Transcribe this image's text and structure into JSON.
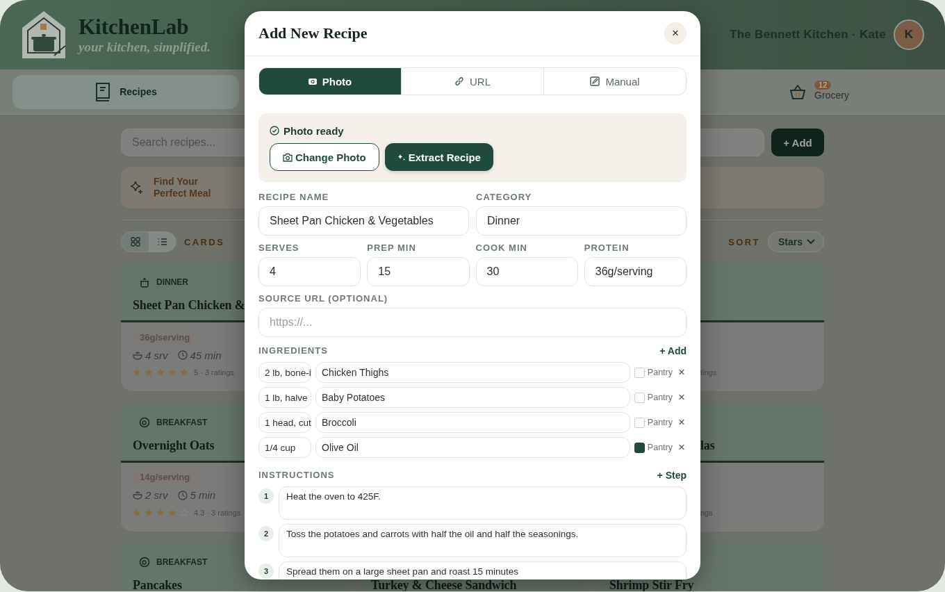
{
  "app": {
    "title": "KitchenLab",
    "tagline": "your kitchen, simplified.",
    "account": "The Bennett Kitchen · Kate",
    "avatar": "K"
  },
  "nav": [
    {
      "label": "Recipes",
      "selected": true
    },
    {
      "label": "Grocery",
      "selected": false,
      "badge": "12"
    }
  ],
  "search": {
    "placeholder": "Search recipes..."
  },
  "add_button": "+ Add",
  "banner": {
    "text": "Find Your Perfect Meal"
  },
  "view": {
    "modes": [
      {
        "selected": true
      },
      {
        "selected": false
      }
    ],
    "label": "CARDS"
  },
  "sort": {
    "label": "SORT",
    "value": "Stars"
  },
  "card_columns": [
    {
      "cards": [
        {
          "kind": "full",
          "category": "DINNER",
          "title": "Sheet Pan Chicken &",
          "protein": "36g/serving",
          "servings": "4 srv",
          "time": "45 min",
          "stars": 5,
          "rating": "5 · 3 ratings"
        },
        {
          "kind": "full",
          "category": "BREAKFAST",
          "title": "Overnight Oats",
          "protein": "14g/serving",
          "servings": "2 srv",
          "time": "5 min",
          "stars": 4,
          "rating": "4.3 · 3 ratings"
        },
        {
          "kind": "full",
          "category": "BREAKFAST",
          "title": "Pancakes"
        }
      ]
    },
    {
      "cards": [
        {
          "kind": "full",
          "title": "Turkey & Cheese Sandwich"
        }
      ]
    },
    {
      "cards": [
        {
          "kind": "fragment",
          "rating": "tings"
        },
        {
          "kind": "fragment",
          "title": "las",
          "rating": "ngs"
        },
        {
          "kind": "full",
          "title": "Shrimp Stir Fry"
        }
      ]
    }
  ],
  "modal": {
    "title": "Add New Recipe",
    "close": "×",
    "tabs": [
      {
        "label": "Photo",
        "selected": true
      },
      {
        "label": "URL",
        "selected": false
      },
      {
        "label": "Manual",
        "selected": false
      }
    ],
    "photo_panel": {
      "status": "Photo ready",
      "buttons": [
        {
          "label": "Change Photo",
          "kind": "outline"
        },
        {
          "label": "Extract Recipe",
          "kind": "primary"
        }
      ]
    },
    "fields": [
      {
        "label": "RECIPE NAME",
        "value": "Sheet Pan Chicken & Vegetables"
      },
      {
        "label": "CATEGORY",
        "value": "Dinner"
      }
    ],
    "numbers": [
      {
        "label": "SERVES",
        "value": "4"
      },
      {
        "label": "PREP MIN",
        "value": "15"
      },
      {
        "label": "COOK MIN",
        "value": "30"
      },
      {
        "label": "PROTEIN",
        "value": "36g/serving"
      }
    ],
    "source": {
      "label": "SOURCE URL (OPTIONAL)",
      "placeholder": "https://..."
    },
    "ingredients": {
      "label": "INGREDIENTS",
      "add": "+ Add",
      "rows": [
        {
          "amount": "2 lb, bone-i",
          "name": "Chicken Thighs",
          "pantry": false,
          "pantry_label": "Pantry",
          "remove": "×"
        },
        {
          "amount": "1 lb, halve",
          "name": "Baby Potatoes",
          "pantry": false,
          "pantry_label": "Pantry",
          "remove": "×"
        },
        {
          "amount": "1 head, cut",
          "name": "Broccoli",
          "pantry": false,
          "pantry_label": "Pantry",
          "remove": "×"
        },
        {
          "amount": "1/4 cup",
          "name": "Olive Oil",
          "pantry": true,
          "pantry_label": "Pantry",
          "remove": "×"
        }
      ]
    },
    "instructions": {
      "label": "INSTRUCTIONS",
      "add": "+ Step",
      "steps": [
        {
          "number": "1",
          "text": "Heat the oven to 425F."
        },
        {
          "number": "2",
          "text": "Toss the potatoes and carrots with half the oil and half the seasonings."
        },
        {
          "number": "3",
          "text": "Spread them on a large sheet pan and roast 15 minutes"
        }
      ]
    }
  }
}
